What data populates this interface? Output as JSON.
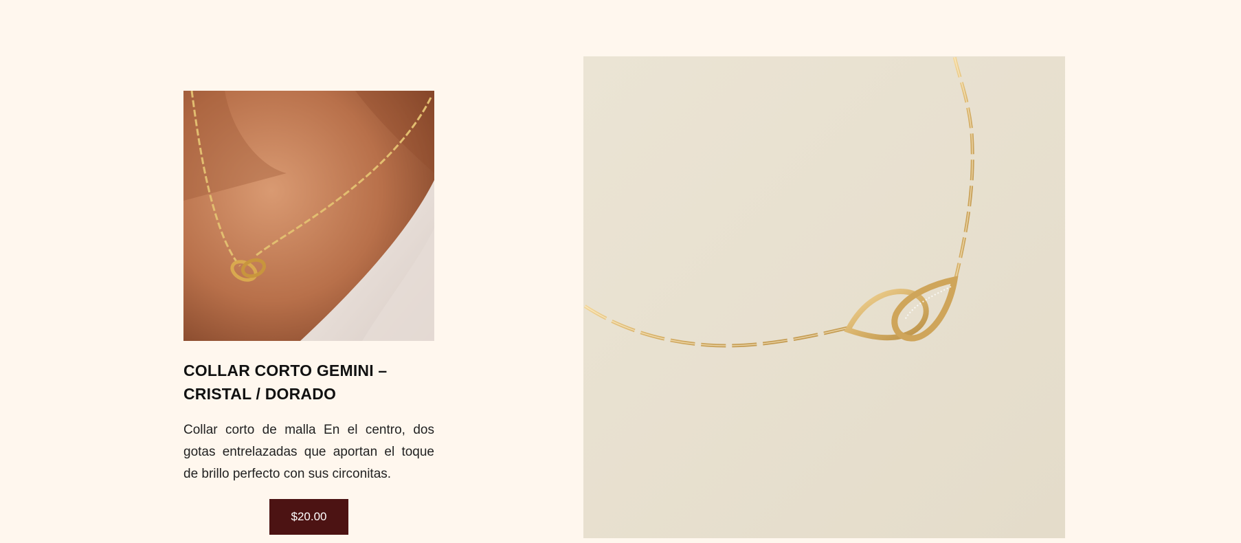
{
  "product": {
    "title": "COLLAR CORTO GEMINI – CRISTAL / DORADO",
    "description": "Collar corto de malla En el centro, dos gotas entrelazadas que aportan el toque de brillo perfecto con sus circonitas.",
    "price_label": "$20.00"
  },
  "images": {
    "model_photo": "necklace-on-model-photo",
    "product_photo": "necklace-product-photo"
  },
  "colors": {
    "page_background": "#fff7ee",
    "button_background": "#4c1313",
    "button_text": "#ffffff",
    "gold": "#d8b26a"
  }
}
